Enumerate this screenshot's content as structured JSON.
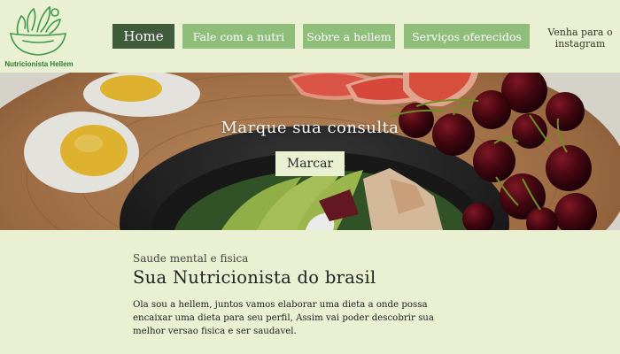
{
  "brand": {
    "name": "Nutricionista Hellem"
  },
  "nav": {
    "items": [
      {
        "label": "Home",
        "active": true
      },
      {
        "label": "Fale com a nutri",
        "active": false
      },
      {
        "label": "Sobre a hellem",
        "active": false
      },
      {
        "label": "Serviços oferecidos",
        "active": false
      }
    ],
    "instagram_label": "Venha para o instagram"
  },
  "hero": {
    "title": "Marque sua consulta",
    "button_label": "Marcar"
  },
  "intro": {
    "eyebrow": "Saude mental e fisica",
    "heading": "Sua Nutricionista do brasil",
    "body": "Ola sou a hellem, juntos vamos elaborar uma dieta a onde possa encaixar uma dieta para seu perfil, Assim vai poder descobrir sua melhor versao fisica e ser saudavel."
  },
  "colors": {
    "background": "#eaf0d2",
    "nav_button": "#8fbe7b",
    "nav_active": "#3f5b3b",
    "brand_green": "#2e7d32"
  }
}
